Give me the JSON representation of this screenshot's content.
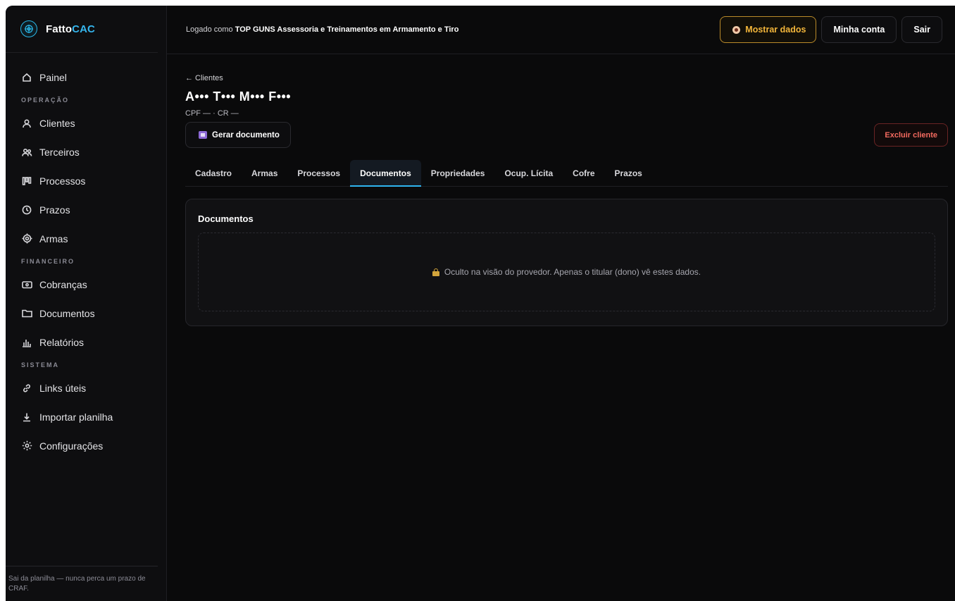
{
  "brand": {
    "name_part1": "Fatto",
    "name_part2": "CAC"
  },
  "sidebar": {
    "items_top": [
      {
        "label": "Painel",
        "icon": "home-icon"
      }
    ],
    "sections": [
      {
        "title": "OPERAÇÃO",
        "items": [
          {
            "label": "Clientes",
            "icon": "user-icon"
          },
          {
            "label": "Terceiros",
            "icon": "users-icon"
          },
          {
            "label": "Processos",
            "icon": "process-icon"
          },
          {
            "label": "Prazos",
            "icon": "clock-icon"
          },
          {
            "label": "Armas",
            "icon": "target-icon"
          }
        ]
      },
      {
        "title": "FINANCEIRO",
        "items": [
          {
            "label": "Cobranças",
            "icon": "money-icon"
          },
          {
            "label": "Documentos",
            "icon": "folder-icon"
          },
          {
            "label": "Relatórios",
            "icon": "chart-icon"
          }
        ]
      },
      {
        "title": "SISTEMA",
        "items": [
          {
            "label": "Links úteis",
            "icon": "link-icon"
          },
          {
            "label": "Importar planilha",
            "icon": "download-icon"
          },
          {
            "label": "Configurações",
            "icon": "settings-icon"
          }
        ]
      }
    ],
    "footer": "Sai da planilha — nunca perca um prazo de CRAF."
  },
  "topbar": {
    "logged_prefix": "Logado como ",
    "logged_user": "TOP GUNS Assessoria e Treinamentos em Armamento e Tiro",
    "show_data": "Mostrar dados",
    "my_account": "Minha conta",
    "logout": "Sair"
  },
  "client": {
    "back": "← Clientes",
    "name": "A••• T••• M••• F•••",
    "meta": "CPF — · CR —",
    "generate_doc": "Gerar documento",
    "delete": "Excluir cliente"
  },
  "tabs": [
    "Cadastro",
    "Armas",
    "Processos",
    "Documentos",
    "Propriedades",
    "Ocup. Lícita",
    "Cofre",
    "Prazos"
  ],
  "active_tab": "Documentos",
  "card": {
    "title": "Documentos",
    "empty_text": "Oculto na visão do provedor. Apenas o titular (dono) vê estes dados."
  },
  "colors": {
    "accent": "#2fb4f0",
    "warning": "#f2b53a",
    "danger": "#f36a5f",
    "background": "#0a0a0b"
  }
}
